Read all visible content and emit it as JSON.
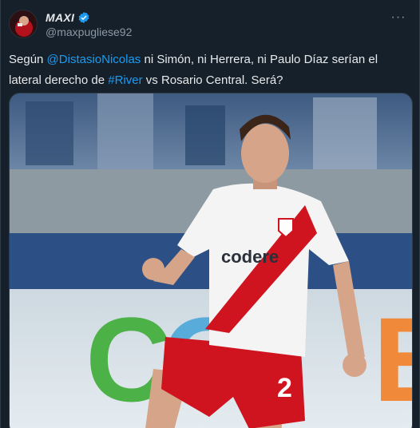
{
  "tweet": {
    "display_name": "MAXI",
    "handle": "@maxpugliese92",
    "more_label": "···",
    "text_parts": {
      "before": "Según ",
      "mention": "@DistasioNicolas",
      "middle": " ni Simón, ni Herrera, ni Paulo Díaz serían el lateral derecho de ",
      "hashtag": "#River",
      "after": " vs Rosario Central.  Será?"
    },
    "media": {
      "sponsor": "codere",
      "jersey_number": "2",
      "board_letters": [
        "C",
        "O",
        "E"
      ]
    }
  },
  "colors": {
    "background": "#15202b",
    "link": "#1d9bf0",
    "text": "#e7e9ea",
    "muted": "#8b98a5",
    "jersey_red": "#d0141f"
  },
  "icons": {
    "verified": "verified-badge-icon",
    "more": "more-options-icon"
  }
}
